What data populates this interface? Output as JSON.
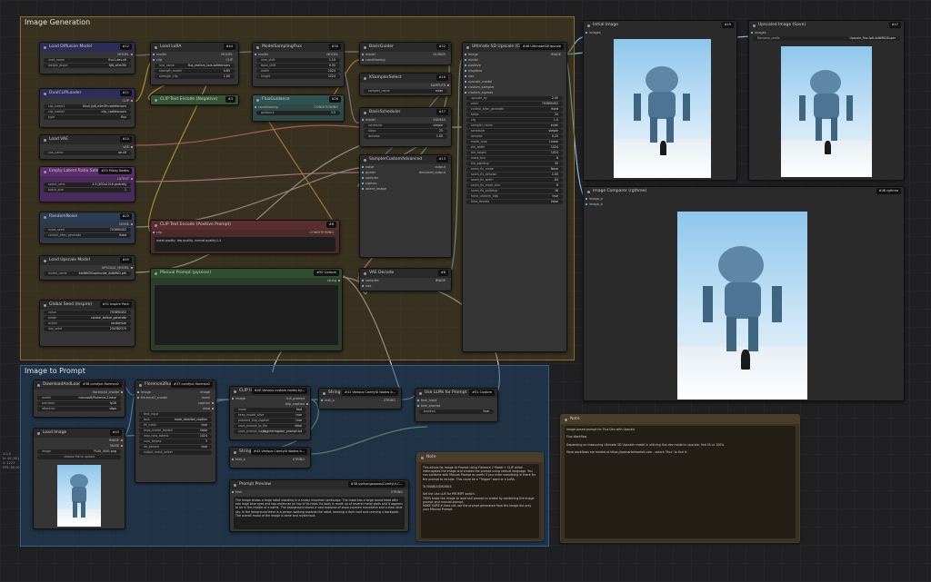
{
  "groups": {
    "image_generation": "Image Generation",
    "image_to_prompt": "Image to Prompt"
  },
  "colors": {
    "gen_group": "#3a3420",
    "gen_border": "#b08a2a",
    "prompt_group": "#1d3448",
    "prompt_border": "#2f5f8c"
  },
  "nodes": {
    "unet": {
      "title": "Load Diffusion Model",
      "badge": "#12",
      "out": "MODEL",
      "w1": "unet_name",
      "v1": "flux1-dev.sft",
      "w2": "weight_dtype",
      "v2": "fp8_e4m3fn"
    },
    "dualclip": {
      "title": "DualCLIPLoader",
      "badge": "#11",
      "out": "CLIP",
      "w1": "clip_name1",
      "v1": "t5xxl_fp8_e4m3fn.safetensors",
      "w2": "clip_name2",
      "v2": "clip_l.safetensors",
      "w3": "type",
      "v3": "flux"
    },
    "vae": {
      "title": "Load VAE",
      "badge": "#10",
      "out": "VAE",
      "w1": "vae_name",
      "v1": "ae.sft"
    },
    "latent": {
      "title": "Empty Latent Ratio Select SDXL (Mikey)",
      "badge": "#53 Mikey Nodes",
      "out": "LATENT",
      "w1": "select_ratio",
      "v1": "2:3 [832x1216 portrait]",
      "w2": "batch_size",
      "v2": "1"
    },
    "noise": {
      "title": "RandomNoise",
      "badge": "#25",
      "out": "NOISE",
      "w1": "noise_seed",
      "v1": "793890452",
      "w2": "control_after_generate",
      "v2": "fixed"
    },
    "upscale": {
      "title": "Load Upscale Model",
      "badge": "#45",
      "out": "UPSCALE_MODEL",
      "w1": "model_name",
      "v1": "4xNMKDSuperscale_4xNMKD.pth"
    },
    "seed": {
      "title": "Global Seed (Inspire)",
      "badge": "#51 Inspire Pack",
      "w1": "value",
      "v1": "793890452",
      "w2": "mode",
      "v2": "control_before_generate",
      "w3": "action",
      "v3": "randomize",
      "w4": "last_seed",
      "v4": "230382379"
    },
    "lora": {
      "title": "Load LoRA",
      "badge": "#44",
      "in1": "model",
      "in2": "clip",
      "out1": "MODEL",
      "out2": "CLIP",
      "w1": "lora_name",
      "v1": "flux_realism_lora.safetensors",
      "w2": "strength_model",
      "v2": "0.65",
      "w3": "strength_clip",
      "v3": "1.00"
    },
    "sampling": {
      "title": "ModelSamplingFlux",
      "badge": "#30",
      "in1": "model",
      "out1": "MODEL",
      "w1": "max_shift",
      "v1": "1.15",
      "w2": "base_shift",
      "v2": "0.50",
      "w3": "width",
      "v3": "1024",
      "w4": "height",
      "v4": "1024"
    },
    "clipneg": {
      "title": "CLIP Text Encode (Negative)",
      "badge": "#3",
      "in1": "clip",
      "out1": "CONDITIONING"
    },
    "guidance": {
      "title": "FluxGuidance",
      "badge": "#26",
      "in1": "conditioning",
      "out1": "CONDITIONING",
      "w1": "guidance",
      "v1": "3.5"
    },
    "guider": {
      "title": "BasicGuider",
      "badge": "#22",
      "in1": "model",
      "in2": "conditioning",
      "out1": "GUIDER"
    },
    "ksampler": {
      "title": "KSamplerSelect",
      "badge": "#16",
      "out1": "SAMPLER",
      "w1": "sampler_name",
      "v1": "euler"
    },
    "scheduler": {
      "title": "BasicScheduler",
      "badge": "#17",
      "in1": "model",
      "out1": "SIGMAS",
      "w1": "scheduler",
      "v1": "simple",
      "w2": "steps",
      "v2": "25",
      "w3": "denoise",
      "v3": "1.00"
    },
    "advsampler": {
      "title": "SamplerCustomAdvanced",
      "badge": "#13",
      "in1": "noise",
      "in2": "guider",
      "in3": "sampler",
      "in4": "sigmas",
      "in5": "latent_image",
      "out1": "output",
      "out2": "denoised_output"
    },
    "clippos": {
      "title": "CLIP Text Encode (Positive Prompt)",
      "badge": "#6",
      "in1": "clip",
      "out1": "CONDITIONING",
      "text": "worst quality, low quality, normal quality:1.4"
    },
    "manual": {
      "title": "Manual Prompt (pysssss)",
      "badge": "#50 Custom",
      "out1": "string"
    },
    "vaedecode": {
      "title": "VAE Decode",
      "badge": "#8",
      "in1": "samples",
      "in2": "vae",
      "out1": "IMAGE"
    },
    "ultimate": {
      "title": "Ultimate SD Upscale (Custom Sample)",
      "badge": "#46 UltimateSDUpscale",
      "in1": "image",
      "in2": "model",
      "in3": "positive",
      "in4": "negative",
      "in5": "vae",
      "in6": "upscale_model",
      "in7": "custom_sampler",
      "in8": "custom_sigmas",
      "out1": "IMAGE",
      "rows": [
        [
          "upscale_by",
          "2.00"
        ],
        [
          "seed",
          "793890452"
        ],
        [
          "control_after_generate",
          "fixed"
        ],
        [
          "steps",
          "20"
        ],
        [
          "cfg",
          "1.0"
        ],
        [
          "sampler_name",
          "euler"
        ],
        [
          "scheduler",
          "simple"
        ],
        [
          "denoise",
          "0.25"
        ],
        [
          "mode_type",
          "Linear"
        ],
        [
          "tile_width",
          "1024"
        ],
        [
          "tile_height",
          "1024"
        ],
        [
          "mask_blur",
          "8"
        ],
        [
          "tile_padding",
          "32"
        ],
        [
          "seam_fix_mode",
          "None"
        ],
        [
          "seam_fix_denoise",
          "1.00"
        ],
        [
          "seam_fix_width",
          "64"
        ],
        [
          "seam_fix_mask_blur",
          "8"
        ],
        [
          "seam_fix_padding",
          "16"
        ],
        [
          "force_uniform_tiles",
          "true"
        ],
        [
          "tiled_decode",
          "false"
        ]
      ]
    },
    "initial": {
      "title": "Initial Image",
      "badge": "#49",
      "in1": "images"
    },
    "upscaled": {
      "title": "Upscaled Image (Save)",
      "badge": "#47",
      "in1": "images",
      "w1": "filename_prefix",
      "v1": "Upscale_flux-fp8-4xNMKDSuper"
    },
    "compare": {
      "title": "Image Comparer (rgthree)",
      "badge": "#48 rgthree",
      "in1": "image_a",
      "in2": "image_b"
    },
    "notetop": {
      "title": "Note",
      "text": "Image-based prompt for Flux Dev with Upscale\n\nFlux Workflow\n\nDepending on measuring Ultimate SD Upscaler model in utilizing flux dev model in upscale, find 50 or 100%.\n\nMore workflows are hosted at https://openartaimarket.com - search \"flux\" to find it."
    },
    "dlflorence": {
      "title": "DownloadAndLoadFlorence2Model",
      "badge": "#38 comfyui-florence2",
      "out1": "florence2_model",
      "w1": "model",
      "v1": "microsoft/Florence-2-base",
      "w2": "precision",
      "v2": "fp16",
      "w3": "attention",
      "v3": "sdpa"
    },
    "loadimage": {
      "title": "Load Image",
      "badge": "#43",
      "out1": "IMAGE",
      "out2": "MASK",
      "w1": "image",
      "v1": "FLUX_0001.png",
      "w2": "upload",
      "v2": "choose file to upload"
    },
    "florence": {
      "title": "Florence2Run",
      "badge": "#37 comfyui-florence2",
      "in1": "image",
      "in2": "florence2_model",
      "out1": "image",
      "out2": "mask",
      "out3": "caption",
      "out4": "data",
      "rows": [
        [
          "text_input",
          ""
        ],
        [
          "task",
          "more_detailed_caption"
        ],
        [
          "fill_mask",
          "true"
        ],
        [
          "keep_model_loaded",
          "false"
        ],
        [
          "max_new_tokens",
          "1024"
        ],
        [
          "num_beams",
          "3"
        ],
        [
          "do_sample",
          "true"
        ],
        [
          "output_mask_select",
          ""
        ]
      ]
    },
    "cliptextenc": {
      "title": "CLIP Interrogator",
      "badge": "#40 Various custom nodes by...",
      "in1": "image",
      "out1": "full_prompt",
      "out2": "blip_caption",
      "rows": [
        [
          "mode",
          "fast"
        ],
        [
          "keep_model_alive",
          "true"
        ],
        [
          "prepend_blip_caption",
          "true"
        ],
        [
          "save_prompt_to_file",
          "false"
        ],
        [
          "save_prompt_to_png",
          "clip_interrogator_prompt.txt"
        ]
      ]
    },
    "concat1": {
      "title": "String Concatenate",
      "badge": "#41 Various ComfyUI Nodes b...",
      "in1": "text_a",
      "in2": "text_b",
      "out1": "STRING"
    },
    "concat2": {
      "title": "String Concatenate",
      "badge": "#42 Various ComfyUI Nodes b...",
      "in1": "text_a",
      "in2": "text_b",
      "out1": "STRING"
    },
    "uselora": {
      "title": "Use LLMs for Prompt",
      "badge": "#51 Custom",
      "in1": "text_input",
      "in2": "text_prompt",
      "w1": "boolean",
      "v1": "true"
    },
    "preview": {
      "title": "Prompt Preview",
      "badge": "#38 pythongosssss/ComfyUI-C...",
      "in1": "text",
      "out1": "STRING",
      "text": "The image shows a large robot standing in a snowy mountain landscape. The robot has a large round head with two large blue eyes and two antennae on top of its head. Its body is made up of several metal parts and it appears to be in the middle of a battle. The background shows a vast expanse of snow-covered mountains and a clear blue sky. In the foreground there is a person walking towards the robot, wearing a dark coat and carrying a backpack. The overall mood of the image is eerie and mysterious."
    },
    "notebottom": {
      "title": "Note",
      "text": "This allows for Image to Prompt using Florence 2 Model + CLIP which interrogates the image and creates the prompt using natural language. You can combine with Manual Prompt as prefix if you enter something in there for the prompt to include. This could be a \"Trigger\" word or a LoRA.\n\nTo ENABLE/DISABLE\n\nSet the Use LLM for PROMPT switch.\nTHEN make the image to load and prompt to create by combining the image prompt and manual prompt.\nMAKE SURE it does not use the prompt generated from the image but only your Manual Prompt."
    }
  },
  "side_info": [
    "1.0.0",
    "N: 40 [40]",
    "V: 1223",
    "FPS: 60.00"
  ]
}
